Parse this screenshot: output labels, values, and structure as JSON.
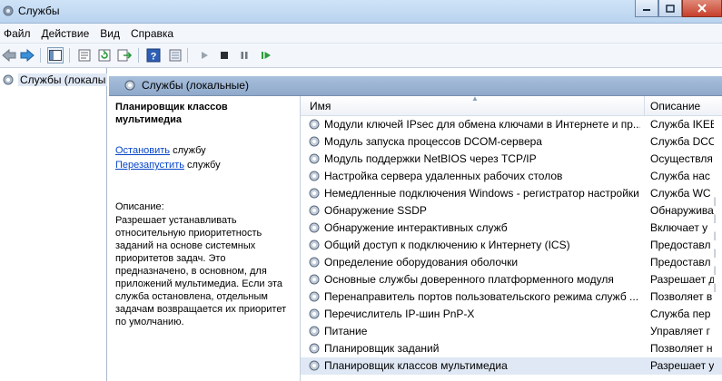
{
  "window": {
    "title": "Службы",
    "icon": "gear-icon",
    "controls": [
      "minimize-icon",
      "maximize-icon",
      "close-icon"
    ]
  },
  "menu": [
    "Файл",
    "Действие",
    "Вид",
    "Справка"
  ],
  "toolbar": {
    "buttons": [
      "back-icon",
      "forward-icon",
      "show-hide-tree-icon",
      "properties-icon",
      "refresh-icon",
      "export-icon",
      "help-icon",
      "console-icon",
      "start-service-icon",
      "stop-service-icon",
      "pause-service-icon",
      "restart-service-icon"
    ]
  },
  "tree": {
    "root": "Службы (локалы"
  },
  "pane_header": "Службы (локальные)",
  "details": {
    "title": "Планировщик классов мультимедиа",
    "stop_link": "Остановить",
    "stop_suffix": " службу",
    "restart_link": "Перезапустить",
    "restart_suffix": " службу",
    "description_label": "Описание:",
    "description_text": "Разрешает устанавливать относительную приоритетность заданий на основе системных приоритетов задач. Это предназначено, в основном, для приложений мультимедиа.  Если эта служба остановлена, отдельным задачам возвращается их приоритет по умолчанию."
  },
  "list": {
    "columns": {
      "name": "Имя",
      "description": "Описание"
    },
    "rows": [
      {
        "name": "Модули ключей IPsec для обмена ключами в Интернете и пр...",
        "description": "Служба IKEE"
      },
      {
        "name": "Модуль запуска процессов DCOM-сервера",
        "description": "Служба DCO"
      },
      {
        "name": "Модуль поддержки NetBIOS через TCP/IP",
        "description": "Осуществля"
      },
      {
        "name": "Настройка сервера удаленных рабочих столов",
        "description": "Служба нас"
      },
      {
        "name": "Немедленные подключения Windows - регистратор настройки",
        "description": "Служба WC"
      },
      {
        "name": "Обнаружение SSDP",
        "description": "Обнаружива"
      },
      {
        "name": "Обнаружение интерактивных служб",
        "description": "Включает у"
      },
      {
        "name": "Общий доступ к подключению к Интернету (ICS)",
        "description": "Предоставл"
      },
      {
        "name": "Определение оборудования оболочки",
        "description": "Предоставл"
      },
      {
        "name": "Основные службы доверенного платформенного модуля",
        "description": "Разрешает д"
      },
      {
        "name": "Перенаправитель портов пользовательского режима служб ...",
        "description": "Позволяет в"
      },
      {
        "name": "Перечислитель IP-шин PnP-X",
        "description": "Служба пер"
      },
      {
        "name": "Питание",
        "description": "Управляет г"
      },
      {
        "name": "Планировщик заданий",
        "description": "Позволяет н"
      },
      {
        "name": "Планировщик классов мультимедиа",
        "description": "Разрешает у"
      }
    ]
  },
  "colors": {
    "header_blue": "#8fa9cb",
    "link": "#0645c8",
    "selection": "#dfe8f4"
  }
}
